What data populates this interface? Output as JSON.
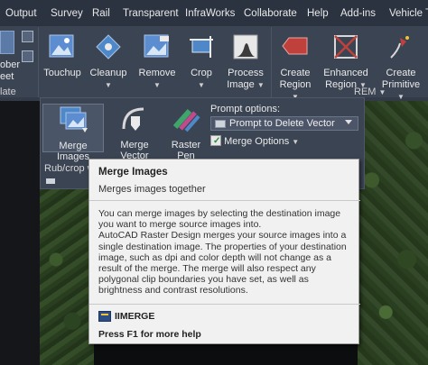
{
  "tabs": [
    "Output",
    "Survey",
    "Rail",
    "Transparent",
    "InfraWorks",
    "Collaborate",
    "Help",
    "Add-ins",
    "Vehicle Tr"
  ],
  "ribbon": {
    "partial_left_label_1": "ober",
    "partial_left_label_2": "eet",
    "partial_left_panel": "late",
    "buttons": [
      {
        "label": "Touchup",
        "chevron": ""
      },
      {
        "label": "Cleanup",
        "chevron": "▼"
      },
      {
        "label": "Remove",
        "chevron": "▼"
      },
      {
        "label": "Crop",
        "chevron": "▼"
      },
      {
        "label": "Process",
        "label2": "Image",
        "chevron": "▼"
      },
      {
        "label": "Create",
        "label2": "Region",
        "chevron": "▼"
      },
      {
        "label": "Enhanced",
        "label2": "Region",
        "chevron": "▼"
      },
      {
        "label": "Create",
        "label2": "Primitive",
        "chevron": "▼"
      }
    ],
    "rem_panel_title": "REM",
    "rem_panel_chevron": "▼"
  },
  "flyout": {
    "buttons": [
      "Merge Images",
      "Merge Vector",
      "Raster Pen"
    ],
    "prompt_label": "Prompt options:",
    "prompt_value": "Prompt to Delete Vector",
    "merge_options_label": "Merge Options",
    "panel_title": "Rub/crop w"
  },
  "tooltip": {
    "title": "Merge Images",
    "subtitle": "Merges images together",
    "desc_1": "You can merge images by selecting the destination image you want to merge source images into.",
    "desc_2": "AutoCAD Raster Design merges your source images into a single destination image. The properties of your destination image, such as dpi and color depth will not change as a result of the merge. The merge will also respect any polygonal clip boundaries you have set, as well as brightness and contrast resolutions.",
    "command": "IIMERGE",
    "help": "Press F1 for more help"
  },
  "colors": {
    "ribbon_bg": "#3b4453",
    "tab_bg": "#2b3340",
    "tooltip_bg": "#f1f1f1",
    "accent_red": "#c0403c"
  }
}
